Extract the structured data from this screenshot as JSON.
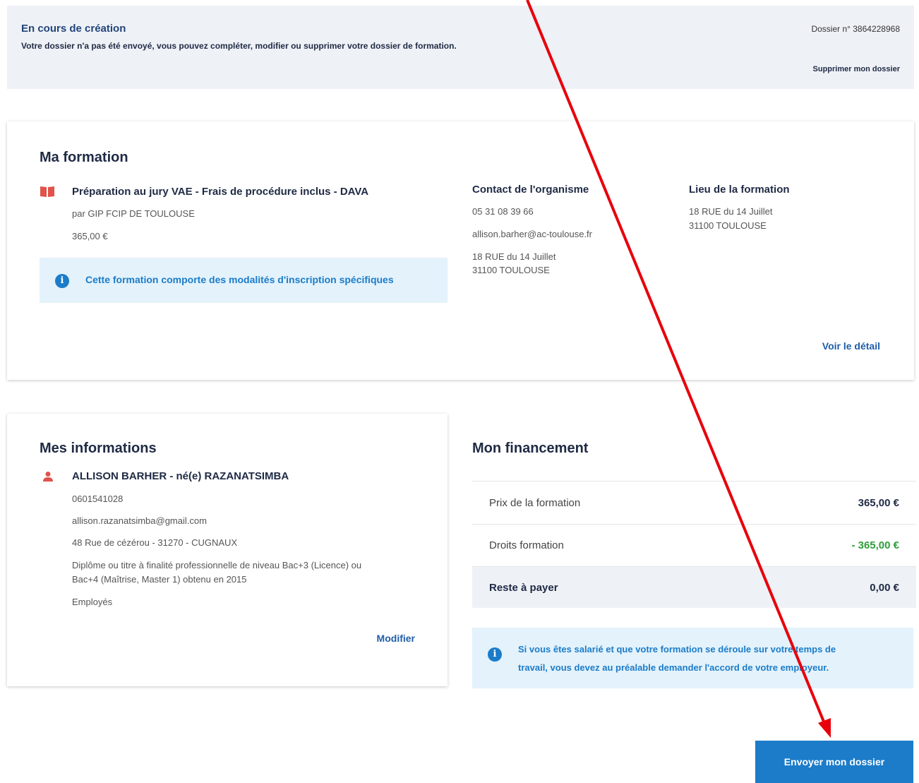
{
  "banner": {
    "status": "En cours de création",
    "description": "Votre dossier n'a pas été envoyé, vous pouvez compléter, modifier ou supprimer votre dossier de formation.",
    "dossier_number": "Dossier n° 3864228968",
    "delete_label": "Supprimer mon dossier"
  },
  "formation": {
    "section_title": "Ma formation",
    "title": "Préparation au jury VAE - Frais de procédure inclus - DAVA",
    "provider": "par GIP FCIP DE TOULOUSE",
    "price": "365,00 €",
    "notice": "Cette formation comporte des modalités d'inscription spécifiques",
    "contact": {
      "heading": "Contact de l'organisme",
      "phone": "05 31 08 39 66",
      "email": "allison.barher@ac-toulouse.fr",
      "address_line1": "18 RUE du 14 Juillet",
      "address_line2": "31100 TOULOUSE"
    },
    "location": {
      "heading": "Lieu de la formation",
      "address_line1": "18 RUE du 14 Juillet",
      "address_line2": "31100 TOULOUSE"
    },
    "detail_link": "Voir le détail"
  },
  "infos": {
    "section_title": "Mes informations",
    "name": "ALLISON BARHER - né(e) RAZANATSIMBA",
    "phone": "0601541028",
    "email": "allison.razanatsimba@gmail.com",
    "address": "48 Rue de cézérou - 31270 - CUGNAUX",
    "diploma_line1": "Diplôme ou titre à finalité professionnelle de niveau Bac+3 (Licence) ou",
    "diploma_line2": "Bac+4 (Maîtrise, Master 1) obtenu en 2015",
    "status": "Employés",
    "edit_link": "Modifier"
  },
  "financement": {
    "section_title": "Mon financement",
    "rows": [
      {
        "label": "Prix de la formation",
        "value": "365,00 €"
      },
      {
        "label": "Droits formation",
        "value": "- 365,00 €"
      },
      {
        "label": "Reste à payer",
        "value": "0,00 €"
      }
    ],
    "notice_line1": "Si vous êtes salarié et que votre formation se déroule sur votre temps de",
    "notice_line2": "travail, vous devez au préalable demander l'accord de votre employeur."
  },
  "actions": {
    "send_label": "Envoyer mon dossier"
  },
  "colors": {
    "accent": "#1c7cc9",
    "credit": "#2e9e3a",
    "arrow": "#e8000b"
  }
}
